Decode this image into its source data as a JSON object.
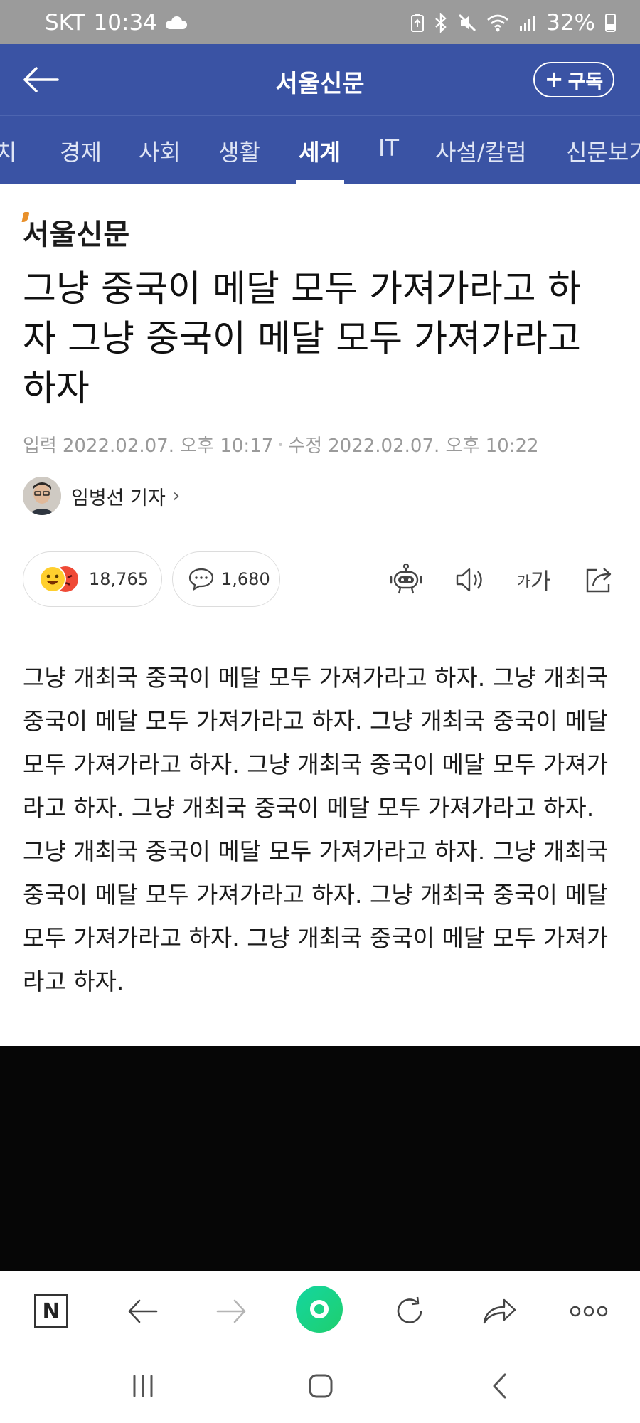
{
  "status_bar": {
    "carrier": "SKT",
    "time": "10:34",
    "battery": "32%",
    "icons": [
      "cloud-icon",
      "battery-saver-icon",
      "bluetooth-icon",
      "mute-icon",
      "wifi-icon",
      "signal-icon",
      "battery-icon"
    ]
  },
  "header": {
    "title": "서울신문",
    "subscribe_label": "구독",
    "back_icon": "arrow-left-icon"
  },
  "tabs": [
    {
      "label": "치"
    },
    {
      "label": "경제"
    },
    {
      "label": "사회"
    },
    {
      "label": "생활"
    },
    {
      "label": "세계",
      "active": true
    },
    {
      "label": "IT"
    },
    {
      "label": "사설/칼럼"
    },
    {
      "label": "신문보기"
    }
  ],
  "article": {
    "brand": "서울신문",
    "headline": "그냥 중국이 메달 모두 가져가라고 하자 그냥 중국이 메달 모두 가져가라고 하자",
    "published_label": "입력",
    "published": "2022.02.07. 오후 10:17",
    "modified_label": "수정",
    "modified": "2022.02.07. 오후 10:22",
    "author": "임병선 기자",
    "reactions_count": "18,765",
    "comments_count": "1,680",
    "font_size_small": "가",
    "font_size_large": "가",
    "body": "그냥 개최국 중국이 메달 모두 가져가라고 하자. 그냥 개최국 중국이 메달 모두 가져가라고 하자. 그냥 개최국 중국이 메달 모두 가져가라고 하자. 그냥 개최국 중국이 메달 모두 가져가라고 하자. 그냥 개최국 중국이 메달 모두 가져가라고 하자. 그냥 개최국 중국이 메달 모두 가져가라고 하자. 그냥 개최국 중국이 메달 모두 가져가라고 하자. 그냥 개최국 중국이 메달 모두 가져가라고 하자. 그냥 개최국 중국이 메달 모두 가져가라고 하자."
  },
  "toolbar_icons": [
    "robot-icon",
    "speaker-icon",
    "font-size-icon",
    "share-icon"
  ],
  "browser_bar": {
    "n_label": "N",
    "icons": [
      "naver-icon",
      "back-icon",
      "forward-icon",
      "green-dot-icon",
      "reload-icon",
      "share-icon",
      "more-icon"
    ]
  },
  "nav_bar": {
    "icons": [
      "recent-apps-icon",
      "home-icon",
      "back-icon"
    ]
  },
  "colors": {
    "header_bg": "#3a53a4",
    "status_bg": "#9b9b9b",
    "brand_accent": "#e8902b",
    "green": "#1fcf6e"
  }
}
